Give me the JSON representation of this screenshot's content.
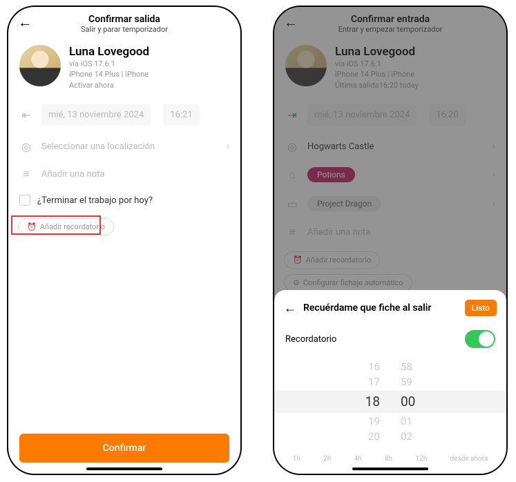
{
  "left": {
    "title": "Confirmar salida",
    "subtitle": "Salir y parar temporizador",
    "user": {
      "name": "Luna Lovegood",
      "os": "vía iOS 17.6.1",
      "dev": "iPhone 14 Plus | iPhone",
      "act": "Activar ahora"
    },
    "date": "mié, 13 noviembre 2024",
    "time": "16:21",
    "loc": "Seleccionar una localización",
    "note": "Añadir una nota",
    "finish": "¿Terminar el trabajo por hoy?",
    "reminder": "Añadir recordatorio",
    "confirm": "Confirmar"
  },
  "right": {
    "title": "Confirmar entrada",
    "subtitle": "Entrar y empezar temporizador",
    "user": {
      "name": "Luna Lovegood",
      "os": "vía iOS 17.6.1",
      "dev": "iPhone 14 Plus | iPhone",
      "act": "Última salida16:20 today"
    },
    "date": "mié, 13 noviembre 2024",
    "time": "16:20",
    "loc": "Hogwarts Castle",
    "tag": "Potions",
    "proj": "Project Dragon",
    "note": "Añadir una nota",
    "reminder": "Añadir recordatorio",
    "auto": "Configurar fichaje automático",
    "sheet": {
      "title": "Recuérdame que fiche al salir",
      "done": "Listo",
      "toggle": "Recordatorio",
      "hours": [
        "16",
        "17",
        "18",
        "19",
        "20"
      ],
      "mins": [
        "58",
        "59",
        "00",
        "01",
        "02"
      ],
      "shortcuts": [
        "1h",
        "2h",
        "4h",
        "8h",
        "12h",
        "desde ahora"
      ]
    }
  }
}
